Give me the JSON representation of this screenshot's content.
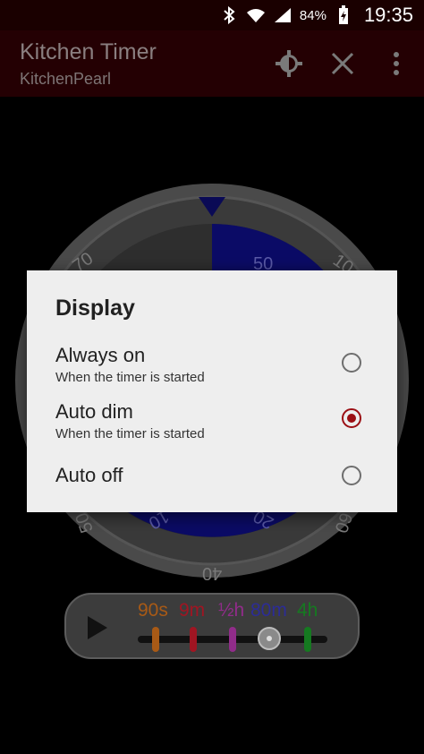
{
  "status_bar": {
    "battery": "84%",
    "time": "19:35",
    "icons": [
      "bluetooth-icon",
      "wifi-icon",
      "signal-icon",
      "battery-charging-icon"
    ]
  },
  "app_bar": {
    "title": "Kitchen Timer",
    "subtitle": "KitchenPearl",
    "actions": [
      "brightness-icon",
      "close-icon",
      "overflow-menu-icon"
    ]
  },
  "dial": {
    "outer_labels": [
      "70",
      "10",
      "50",
      "40",
      "60"
    ],
    "inner_labels": [
      "50",
      "10",
      "20"
    ]
  },
  "presets": {
    "labels": [
      "90s",
      "9m",
      "½h",
      "80m",
      "4h"
    ],
    "colors": [
      "#e07b1a",
      "#d01a2a",
      "#c03ab8",
      "#3a3ac8",
      "#1a9a2a"
    ]
  },
  "dialog": {
    "title": "Display",
    "options": [
      {
        "label": "Always on",
        "sublabel": "When the timer is started",
        "selected": false
      },
      {
        "label": "Auto dim",
        "sublabel": "When the timer is started",
        "selected": true
      },
      {
        "label": "Auto off",
        "sublabel": "",
        "selected": false
      }
    ]
  },
  "colors": {
    "accent": "#9b0f14",
    "dialog_bg": "#eeeeee",
    "app_bar": "#240003"
  }
}
